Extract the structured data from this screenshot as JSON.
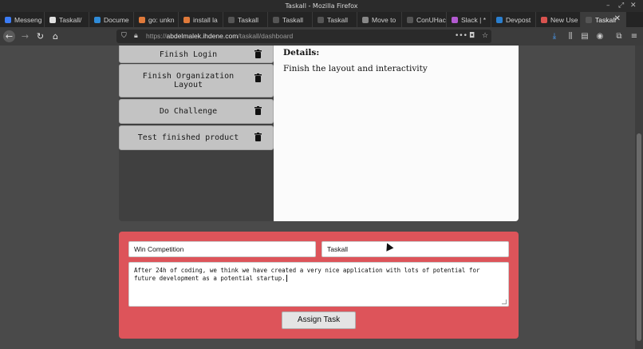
{
  "window": {
    "title": "Taskall - Mozilla Firefox"
  },
  "tabs": [
    {
      "label": "Messeng",
      "color": "#3b7cf5"
    },
    {
      "label": "Taskall/",
      "color": "#e0e0e0"
    },
    {
      "label": "Docume",
      "color": "#2f8bd8"
    },
    {
      "label": "go: unkn",
      "color": "#e07a3a"
    },
    {
      "label": "install la",
      "color": "#e07a3a"
    },
    {
      "label": "Taskall",
      "color": "#555555"
    },
    {
      "label": "Taskall",
      "color": "#555555"
    },
    {
      "label": "Taskall",
      "color": "#555555"
    },
    {
      "label": "Move to",
      "color": "#888888"
    },
    {
      "label": "ConUHacks",
      "color": "#555555"
    },
    {
      "label": "Slack | *",
      "color": "#b35ad1"
    },
    {
      "label": "Devpost",
      "color": "#2a7fcf"
    },
    {
      "label": "New Use",
      "color": "#d9534f"
    },
    {
      "label": "Taskall",
      "color": "#555555",
      "active": true
    }
  ],
  "url": {
    "prefix": "https://",
    "domain": "abdelmalek.ihdene.com",
    "path": "/taskall/dashboard"
  },
  "tasks": [
    {
      "label": "Finish Login"
    },
    {
      "label": "Finish Organization Layout"
    },
    {
      "label": "Do Challenge"
    },
    {
      "label": "Test finished product"
    }
  ],
  "details": {
    "heading": "Details:",
    "text": "Finish the layout and interactivity"
  },
  "form": {
    "task_name": "Win Competition",
    "project": "Taskall",
    "description": "After 24h of coding, we think we have created a very nice application with lots of potential for future development as a potential startup.",
    "submit_label": "Assign Task"
  },
  "colors": {
    "form_bg": "#dd545a",
    "details_bg": "#fbfbfb",
    "task_bg": "#c3c3c3"
  }
}
